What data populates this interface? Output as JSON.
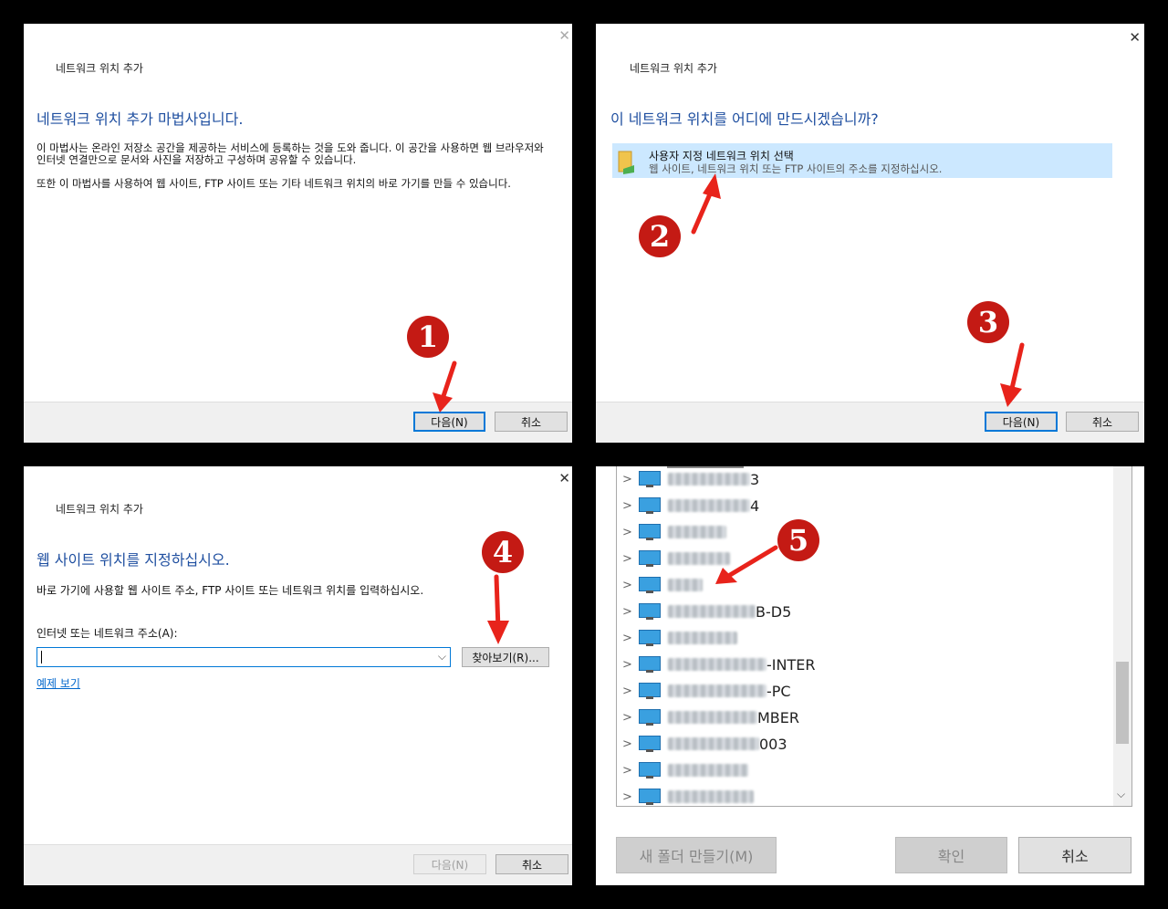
{
  "panel1": {
    "window_title": "네트워크 위치 추가",
    "heading": "네트워크 위치 추가 마법사입니다.",
    "paragraph1": "이 마법사는 온라인 저장소 공간을 제공하는 서비스에 등록하는 것을 도와 줍니다. 이 공간을 사용하면 웹 브라우저와 인터넷 연결만으로 문서와 사진을 저장하고 구성하며 공유할 수 있습니다.",
    "paragraph2": "또한 이 마법사를 사용하여 웹 사이트, FTP 사이트 또는 기타 네트워크 위치의 바로 가기를 만들 수 있습니다.",
    "next_label": "다음(N)",
    "cancel_label": "취소",
    "step": "1"
  },
  "panel2": {
    "window_title": "네트워크 위치 추가",
    "heading": "이 네트워크 위치를 어디에 만드시겠습니까?",
    "option_title": "사용자 지정 네트워크 위치 선택",
    "option_desc": "웹 사이트, 네트워크 위치 또는 FTP 사이트의 주소를 지정하십시오.",
    "next_label": "다음(N)",
    "cancel_label": "취소",
    "step_option": "2",
    "step_next": "3"
  },
  "panel3": {
    "window_title": "네트워크 위치 추가",
    "heading": "웹 사이트 위치를 지정하십시오.",
    "instruction": "바로 가기에 사용할 웹 사이트 주소, FTP 사이트 또는 네트워크 위치를 입력하십시오.",
    "field_label": "인터넷 또는 네트워크 주소(A):",
    "field_value": "",
    "browse_label": "찾아보기(R)...",
    "examples_link": "예제 보기",
    "next_label": "다음(N)",
    "cancel_label": "취소",
    "step": "4"
  },
  "panel4": {
    "rows": [
      {
        "suffix": "3"
      },
      {
        "suffix": "4"
      },
      {
        "suffix": ""
      },
      {
        "suffix": ""
      },
      {
        "suffix": ""
      },
      {
        "suffix": "B-D5"
      },
      {
        "suffix": ""
      },
      {
        "suffix": "-INTER"
      },
      {
        "suffix": "-PC"
      },
      {
        "suffix": "MBER"
      },
      {
        "suffix": "003"
      },
      {
        "suffix": ""
      },
      {
        "suffix": ""
      }
    ],
    "new_folder_label": "새 폴더 만들기(M)",
    "ok_label": "확인",
    "cancel_label": "취소",
    "step": "5"
  },
  "colors": {
    "heading_blue": "#1f4fa0",
    "marker_red": "#c41a14",
    "selection": "#cce8ff"
  }
}
